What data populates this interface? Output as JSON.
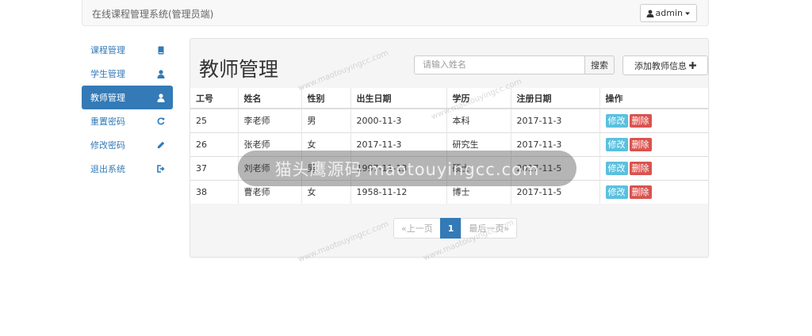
{
  "navbar": {
    "brand": "在线课程管理系统(管理员端)",
    "user": "admin"
  },
  "sidebar": {
    "items": [
      {
        "label": "课程管理",
        "icon": "book-icon",
        "active": false
      },
      {
        "label": "学生管理",
        "icon": "user-icon",
        "active": false
      },
      {
        "label": "教师管理",
        "icon": "user-icon",
        "active": true
      },
      {
        "label": "重置密码",
        "icon": "refresh-icon",
        "active": false
      },
      {
        "label": "修改密码",
        "icon": "pencil-icon",
        "active": false
      },
      {
        "label": "退出系统",
        "icon": "logout-icon",
        "active": false
      }
    ]
  },
  "main": {
    "title": "教师管理",
    "search_placeholder": "请输入姓名",
    "search_label": "搜索",
    "add_label": "添加教师信息",
    "table": {
      "headers": [
        "工号",
        "姓名",
        "性别",
        "出生日期",
        "学历",
        "注册日期",
        "操作"
      ],
      "rows": [
        [
          "25",
          "李老师",
          "男",
          "2000-11-3",
          "本科",
          "2017-11-3"
        ],
        [
          "26",
          "张老师",
          "女",
          "2017-11-3",
          "研究生",
          "2017-11-3"
        ],
        [
          "37",
          "刘老师",
          "男",
          "1997-11-13",
          "硕士",
          "2017-11-5"
        ],
        [
          "38",
          "曹老师",
          "女",
          "1958-11-12",
          "博士",
          "2017-11-5"
        ]
      ],
      "edit_label": "修改",
      "delete_label": "删除"
    },
    "pagination": {
      "prev": "«上一页",
      "current": "1",
      "last": "最后一页»"
    }
  },
  "watermark": {
    "band": "猫头鹰源码 maotouyingcc.com",
    "small": "www.maotouyingcc.com"
  },
  "colors": {
    "primary": "#337ab7",
    "info": "#5bc0de",
    "danger": "#d9534f"
  }
}
